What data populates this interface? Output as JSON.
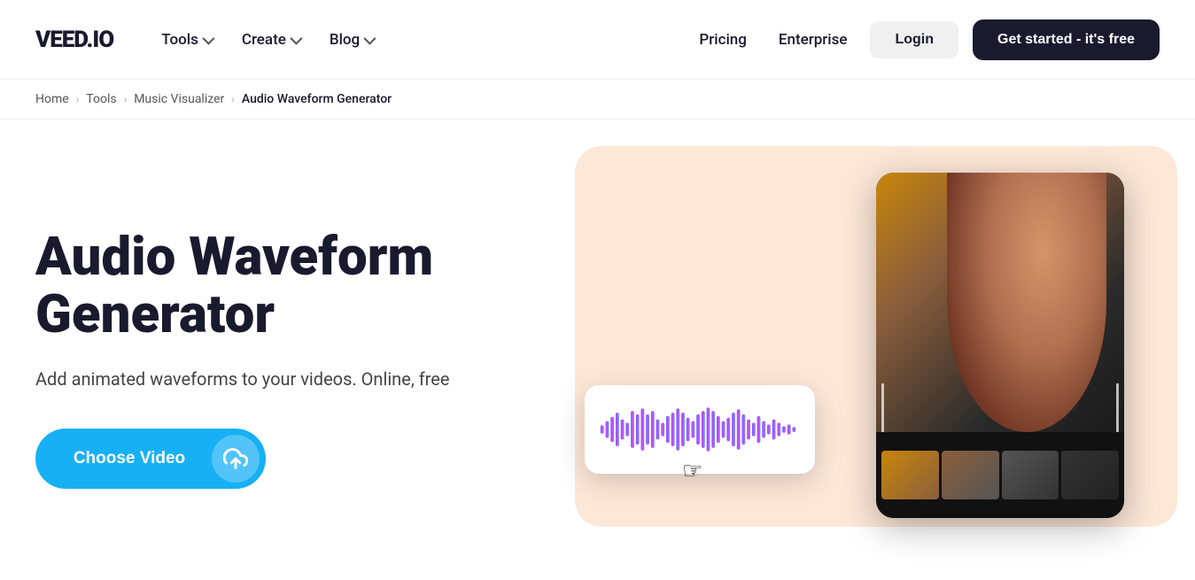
{
  "header": {
    "logo": "VEED.IO",
    "nav_left": [
      {
        "label": "Tools",
        "has_dropdown": true
      },
      {
        "label": "Create",
        "has_dropdown": true
      },
      {
        "label": "Blog",
        "has_dropdown": true
      }
    ],
    "nav_right": [
      {
        "label": "Pricing",
        "type": "link"
      },
      {
        "label": "Enterprise",
        "type": "link"
      }
    ],
    "login_label": "Login",
    "cta_label": "Get started - it's free"
  },
  "breadcrumb": {
    "items": [
      "Home",
      "Tools",
      "Music Visualizer",
      "Audio Waveform Generator"
    ]
  },
  "hero": {
    "title": "Audio Waveform Generator",
    "subtitle": "Add animated waveforms to your videos. Online, free",
    "cta_label": "Choose Video"
  }
}
